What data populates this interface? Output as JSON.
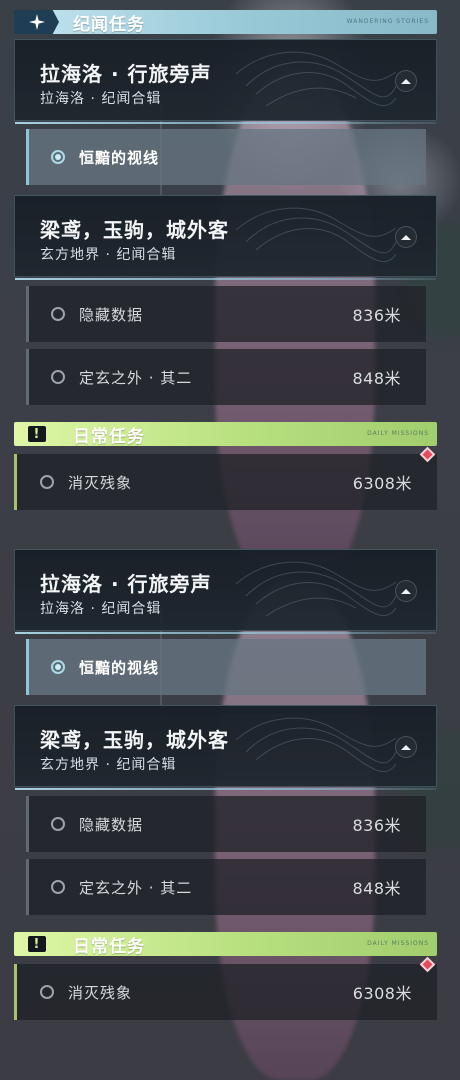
{
  "story_section": {
    "title": "纪闻任务",
    "deco": "WANDERING STORIES"
  },
  "quest1": {
    "title": "拉海洛 · 行旅旁声",
    "subtitle": "拉海洛 · 纪闻合辑",
    "items": [
      {
        "label": "恒黯的视线",
        "selected": true
      }
    ]
  },
  "quest2": {
    "title": "梁鸢，玉驹，城外客",
    "subtitle": "玄方地界 · 纪闻合辑",
    "items": [
      {
        "label": "隐藏数据",
        "distance": "836米"
      },
      {
        "label": "定玄之外 · 其二",
        "distance": "848米"
      }
    ]
  },
  "daily_section": {
    "title": "日常任务",
    "deco": "DAILY MISSIONS"
  },
  "daily_item": {
    "label": "消灭残象",
    "distance": "6308米"
  },
  "colors": {
    "story_accent": "#98c9d7",
    "daily_accent": "#b7e07f",
    "tracked_marker": "#e54b5f"
  },
  "icons": {
    "story": "sparkle-icon",
    "daily": "exclamation-icon",
    "collapse": "chevron-up-icon",
    "marker": "diamond-icon"
  }
}
